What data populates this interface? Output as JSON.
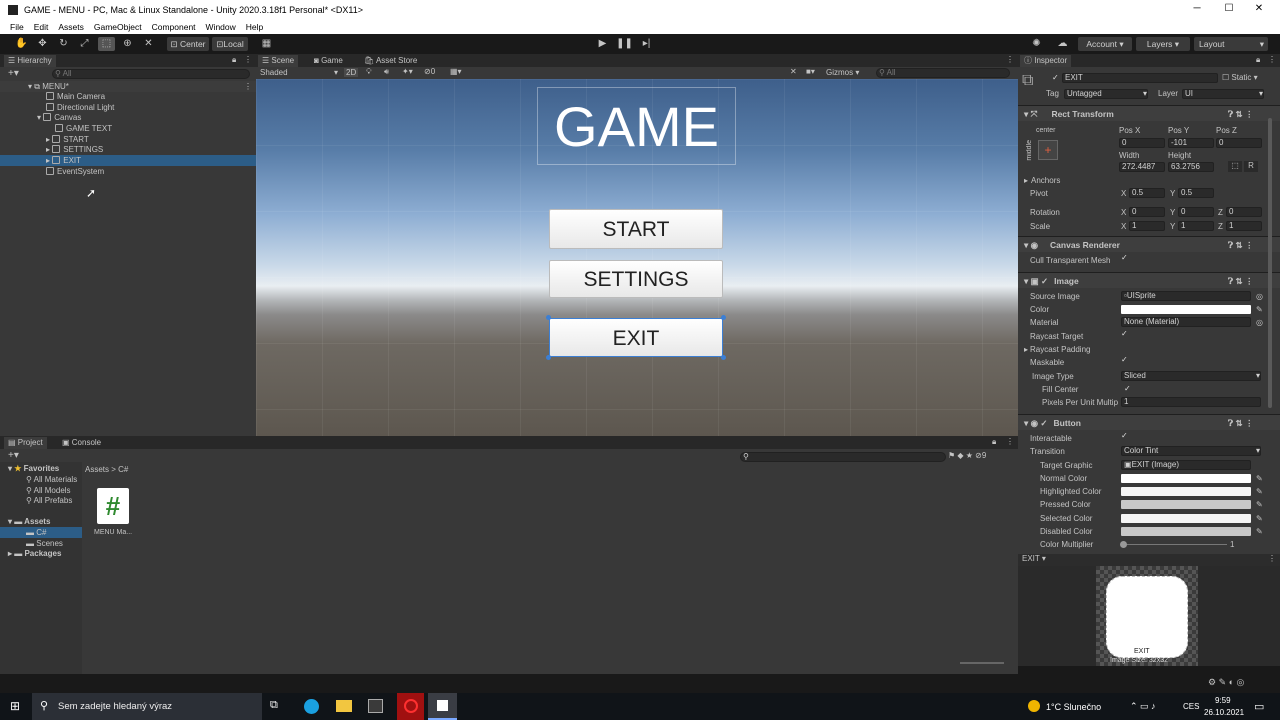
{
  "window": {
    "title": "GAME - MENU - PC, Mac & Linux Standalone - Unity 2020.3.18f1 Personal* <DX11>"
  },
  "menu": [
    "File",
    "Edit",
    "Assets",
    "GameObject",
    "Component",
    "Window",
    "Help"
  ],
  "toolbar": {
    "center": "Center",
    "local": "Local",
    "account": "Account",
    "layers": "Layers",
    "layout": "Layout"
  },
  "hierarchy": {
    "tab": "Hierarchy",
    "search_placeholder": "All",
    "items": [
      {
        "label": "MENU*",
        "depth": 0
      },
      {
        "label": "Main Camera",
        "depth": 1
      },
      {
        "label": "Directional Light",
        "depth": 1
      },
      {
        "label": "Canvas",
        "depth": 1
      },
      {
        "label": "GAME TEXT",
        "depth": 2
      },
      {
        "label": "START",
        "depth": 2
      },
      {
        "label": "SETTINGS",
        "depth": 2
      },
      {
        "label": "EXIT",
        "depth": 2
      },
      {
        "label": "EventSystem",
        "depth": 1
      }
    ]
  },
  "scene": {
    "tabs": [
      "Scene",
      "Game",
      "Asset Store"
    ],
    "shading": "Shaded",
    "mode2d": "2D",
    "gizmos": "Gizmos",
    "search": "All",
    "hidden_count": "0",
    "title": "GAME",
    "buttons": [
      "START",
      "SETTINGS",
      "EXIT"
    ]
  },
  "inspector": {
    "tab": "Inspector",
    "object": "EXIT",
    "static": "Static",
    "tag_label": "Tag",
    "tag": "Untagged",
    "layer_label": "Layer",
    "layer": "UI",
    "rect": {
      "title": "Rect Transform",
      "anchor_h": "center",
      "anchor_v": "middle",
      "posx_l": "Pos X",
      "posy_l": "Pos Y",
      "posz_l": "Pos Z",
      "posx": "0",
      "posy": "-101",
      "posz": "0",
      "w_l": "Width",
      "h_l": "Height",
      "w": "272.4487",
      "h": "63.2756",
      "anchors": "Anchors",
      "pivot": "Pivot",
      "pivot_x": "0.5",
      "pivot_y": "0.5",
      "rotation": "Rotation",
      "rx": "0",
      "ry": "0",
      "rz": "0",
      "scale": "Scale",
      "sx": "1",
      "sy": "1",
      "sz": "1",
      "x": "X",
      "y": "Y",
      "z": "Z",
      "r": "R"
    },
    "canvas_renderer": {
      "title": "Canvas Renderer",
      "cull": "Cull Transparent Mesh"
    },
    "image": {
      "title": "Image",
      "source_l": "Source Image",
      "source": "UISprite",
      "color_l": "Color",
      "material_l": "Material",
      "material": "None (Material)",
      "raycast_l": "Raycast Target",
      "padding_l": "Raycast Padding",
      "maskable_l": "Maskable",
      "type_l": "Image Type",
      "type": "Sliced",
      "fill_l": "Fill Center",
      "ppu_l": "Pixels Per Unit Multip",
      "ppu": "1"
    },
    "button": {
      "title": "Button",
      "interactable_l": "Interactable",
      "transition_l": "Transition",
      "transition": "Color Tint",
      "target_l": "Target Graphic",
      "target": "EXIT (Image)",
      "normal_l": "Normal Color",
      "highlighted_l": "Highlighted Color",
      "pressed_l": "Pressed Color",
      "selected_l": "Selected Color",
      "disabled_l": "Disabled Color",
      "multiplier_l": "Color Multiplier",
      "multiplier": "1"
    },
    "preview": {
      "name": "EXIT",
      "label": "EXIT",
      "size": "Image Size: 32x32"
    }
  },
  "project": {
    "tabs": [
      "Project",
      "Console"
    ],
    "favorites": "Favorites",
    "fav_items": [
      "All Materials",
      "All Models",
      "All Prefabs"
    ],
    "assets": "Assets",
    "asset_items": [
      "C#",
      "Scenes"
    ],
    "packages": "Packages",
    "breadcrumb": [
      "Assets",
      "C#"
    ],
    "file": "MENU Ma...",
    "count": "9"
  },
  "taskbar": {
    "search": "Sem zadejte hledaný výraz",
    "weather": "1°C Slunečno",
    "lang": "CES",
    "time": "9:59",
    "date": "26.10.2021"
  }
}
